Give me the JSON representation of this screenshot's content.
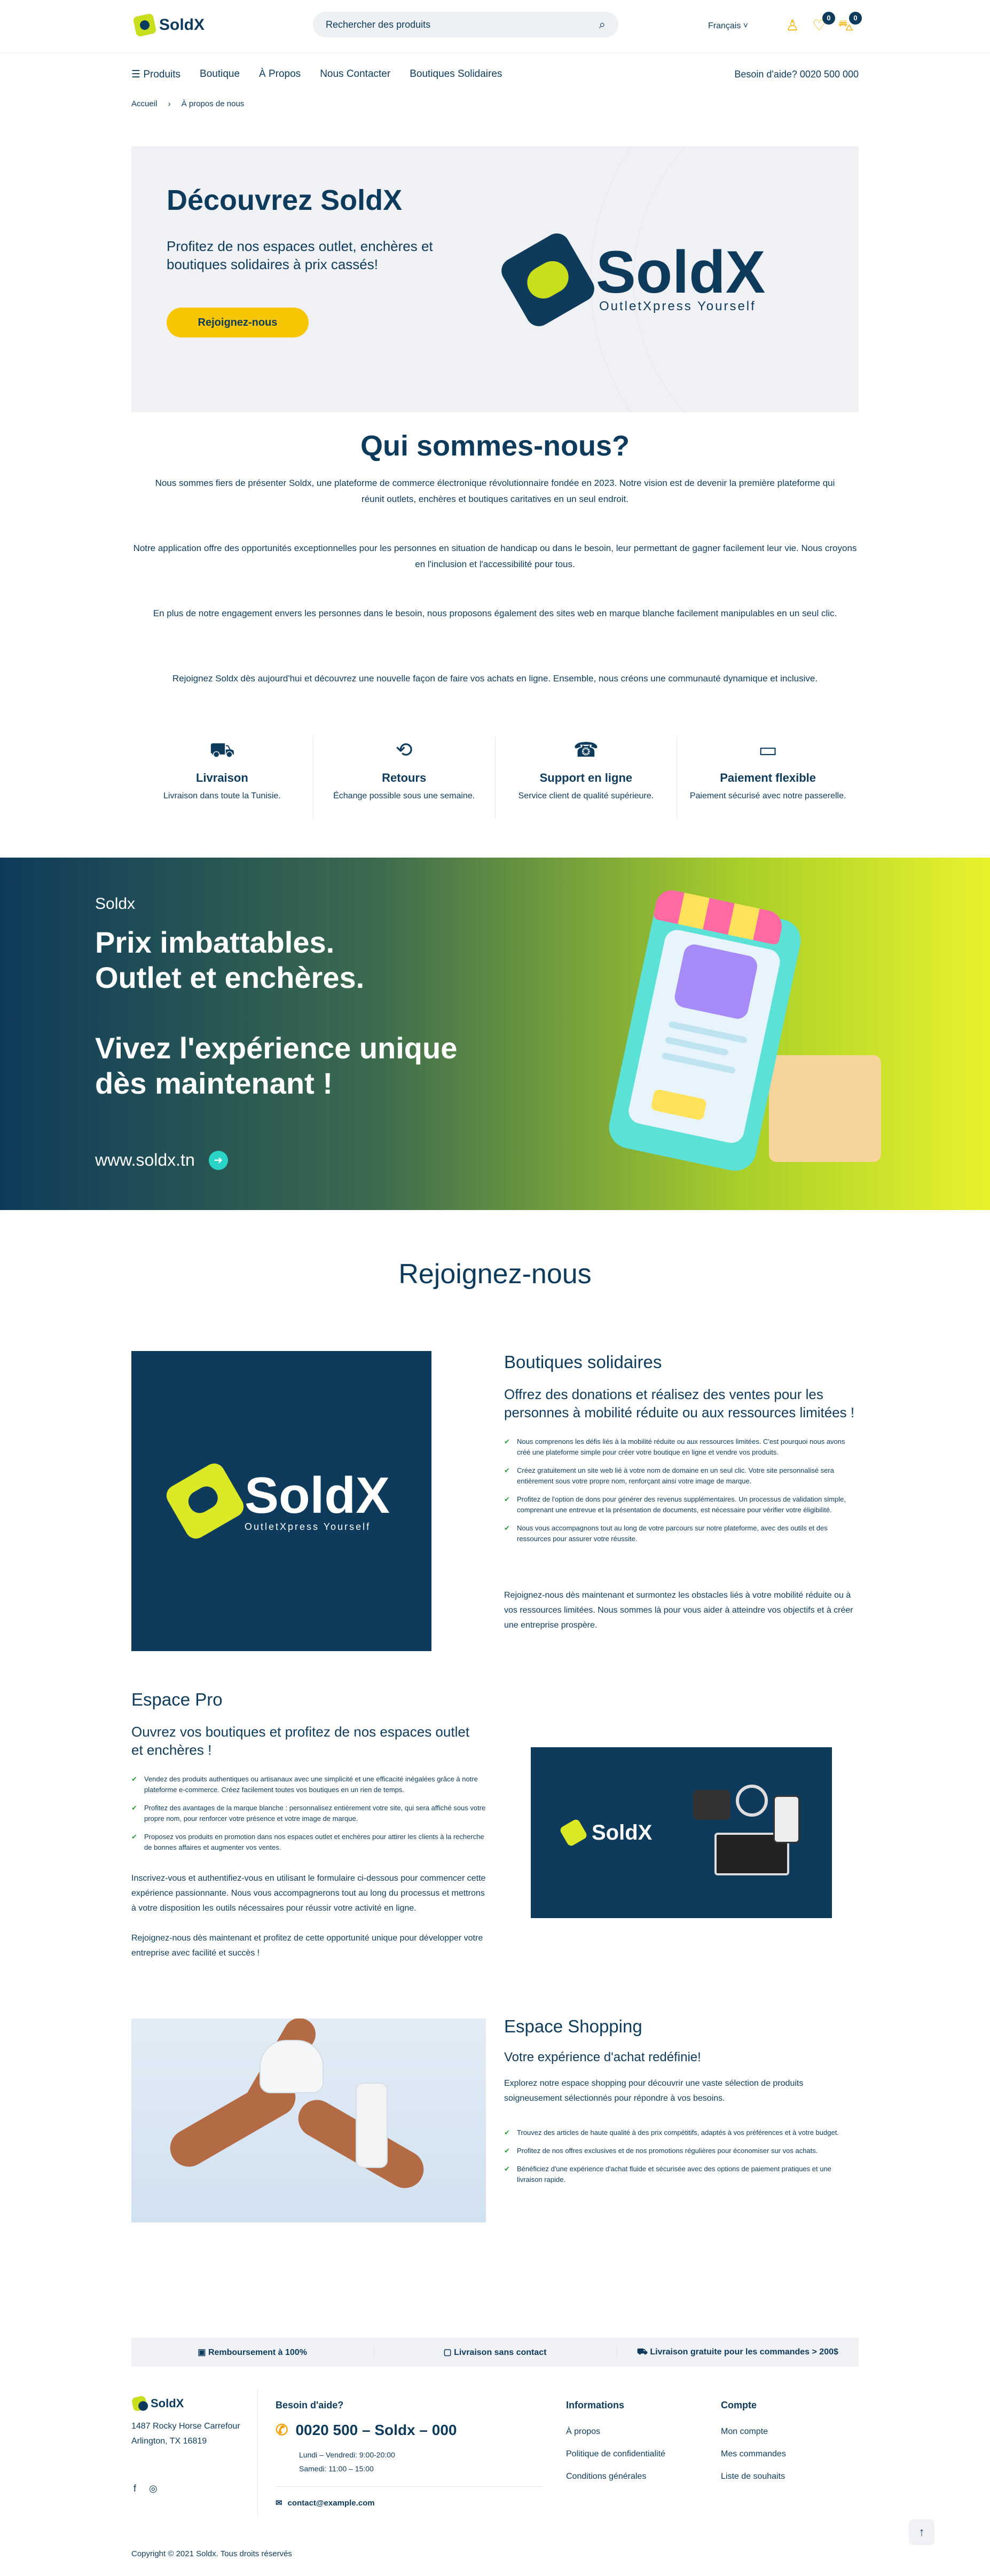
{
  "header": {
    "brand": "SoldX",
    "search_placeholder": "Rechercher des produits",
    "language": "Français",
    "wishlist_count": "0",
    "cart_count": "0"
  },
  "nav": {
    "items": [
      "Produits",
      "Boutique",
      "À Propos",
      "Nous Contacter",
      "Boutiques Solidaires"
    ],
    "help": "Besoin d'aide? 0020 500 000"
  },
  "breadcrumb": {
    "home": "Accueil",
    "sep": "›",
    "current": "À propos de nous"
  },
  "hero": {
    "title": "Découvrez SoldX",
    "subtitle": "Profitez de nos espaces outlet, enchères et boutiques solidaires à prix cassés!",
    "button": "Rejoignez-nous",
    "logo_text": "SoldX",
    "logo_tagline": "OutletXpress Yourself"
  },
  "about": {
    "title": "Qui sommes-nous?",
    "p1": "Nous sommes fiers de présenter Soldx, une plateforme de commerce électronique révolutionnaire fondée en 2023. Notre vision est de devenir la première plateforme qui réunit outlets, enchères et boutiques caritatives en un seul endroit.",
    "p2": "Notre application offre des opportunités exceptionnelles pour les personnes en situation de handicap ou dans le besoin, leur permettant de gagner facilement leur vie. Nous croyons en l'inclusion et l'accessibilité pour tous.",
    "p3": "En plus de notre engagement envers les personnes dans le besoin, nous proposons également des sites web en marque blanche facilement manipulables en un seul clic.",
    "p4": "Rejoignez Soldx dès aujourd'hui et découvrez une nouvelle façon de faire vos achats en ligne. Ensemble, nous créons une communauté dynamique et inclusive."
  },
  "features": [
    {
      "icon": "truck-icon",
      "title": "Livraison",
      "desc": "Livraison dans toute la Tunisie."
    },
    {
      "icon": "returns-icon",
      "title": "Retours",
      "desc": "Échange possible sous une semaine."
    },
    {
      "icon": "support-icon",
      "title": "Support en ligne",
      "desc": "Service client de qualité supérieure."
    },
    {
      "icon": "card-icon",
      "title": "Paiement flexible",
      "desc": "Paiement sécurisé avec notre passerelle."
    }
  ],
  "banner": {
    "small": "Soldx",
    "line1": "Prix imbattables.",
    "line2": "Outlet et enchères.",
    "line3": "Vivez l'expérience unique dès maintenant !",
    "url": "www.soldx.tn"
  },
  "join": {
    "title": "Rejoignez-nous",
    "logo_text": "SoldX",
    "logo_tagline": "OutletXpress Yourself",
    "solidaires": {
      "title": "Boutiques solidaires",
      "subtitle": "Offrez des donations et réalisez des ventes pour les personnes à mobilité réduite ou aux ressources limitées !",
      "bullets": [
        "Nous comprenons les défis liés à la mobilité réduite ou aux ressources limitées. C'est pourquoi nous avons créé une plateforme simple pour créer votre boutique en ligne et vendre vos produits.",
        "Créez gratuitement un site web lié à votre nom de domaine en un seul clic. Votre site personnalisé sera entièrement sous votre propre nom, renforçant ainsi votre image de marque.",
        "Profitez de l'option de dons pour générer des revenus supplémentaires. Un processus de validation simple, comprenant une entrevue et la présentation de documents, est nécessaire pour vérifier votre éligibilité.",
        "Nous vous accompagnons tout au long de votre parcours sur notre plateforme, avec des outils et des ressources pour assurer votre réussite."
      ],
      "para": "Rejoignez-nous dès maintenant et surmontez les obstacles liés à votre mobilité réduite ou à vos ressources limitées. Nous sommes là pour vous aider à atteindre vos objectifs et à créer une entreprise prospère."
    },
    "pro": {
      "title": "Espace Pro",
      "subtitle": "Ouvrez vos boutiques et profitez de nos espaces outlet et enchères !",
      "bullets": [
        "Vendez des produits authentiques ou artisanaux avec une simplicité et une efficacité inégalées grâce à notre plateforme e-commerce. Créez facilement toutes vos boutiques en un rien de temps.",
        "Profitez des avantages de la marque blanche : personnalisez entièrement votre site, qui sera affiché sous votre propre nom, pour renforcer votre présence et votre image de marque.",
        "Proposez vos produits en promotion dans nos espaces outlet et enchères pour attirer les clients à la recherche de bonnes affaires et augmenter vos ventes."
      ],
      "para1": "Inscrivez-vous et authentifiez-vous en utilisant le formulaire ci-dessous pour commencer cette expérience passionnante. Nous vous accompagnerons tout au long du processus et mettrons à votre disposition les outils nécessaires pour réussir votre activité en ligne.",
      "para2": "Rejoignez-nous dès maintenant et profitez de cette opportunité unique pour développer votre entreprise avec facilité et succès !",
      "logo_text": "SoldX"
    },
    "shopping": {
      "title": "Espace Shopping",
      "subtitle": "Votre expérience d'achat redéfinie!",
      "intro": "Explorez notre espace shopping pour découvrir une vaste sélection de produits soigneusement sélectionnés pour répondre à vos besoins.",
      "bullets": [
        "Trouvez des articles de haute qualité à des prix compétitifs, adaptés à vos préférences et à votre budget.",
        "Profitez de nos offres exclusives et de nos promotions régulières pour économiser sur vos achats.",
        "Bénéficiez d'une expérience d'achat fluide et sécurisée avec des options de paiement pratiques et une livraison rapide."
      ]
    }
  },
  "footer": {
    "bar": [
      "Remboursement à 100%",
      "Livraison sans contact",
      "Livraison gratuite pour les commandes > 200$"
    ],
    "brand": "SoldX",
    "address1": "1487 Rocky Horse Carrefour",
    "address2": "Arlington, TX 16819",
    "help_title": "Besoin d'aide?",
    "phone": "0020 500 – Soldx – 000",
    "hours1": "Lundi – Vendredi: 9:00-20:00",
    "hours2": "Samedi: 11:00 – 15:00",
    "email": "contact@example.com",
    "info_title": "Informations",
    "info_links": [
      "À propos",
      "Politique de confidentialité",
      "Conditions générales"
    ],
    "account_title": "Compte",
    "account_links": [
      "Mon compte",
      "Mes commandes",
      "Liste de souhaits"
    ],
    "copyright": "Copyright © 2021 Soldx. Tous droits réservés"
  }
}
